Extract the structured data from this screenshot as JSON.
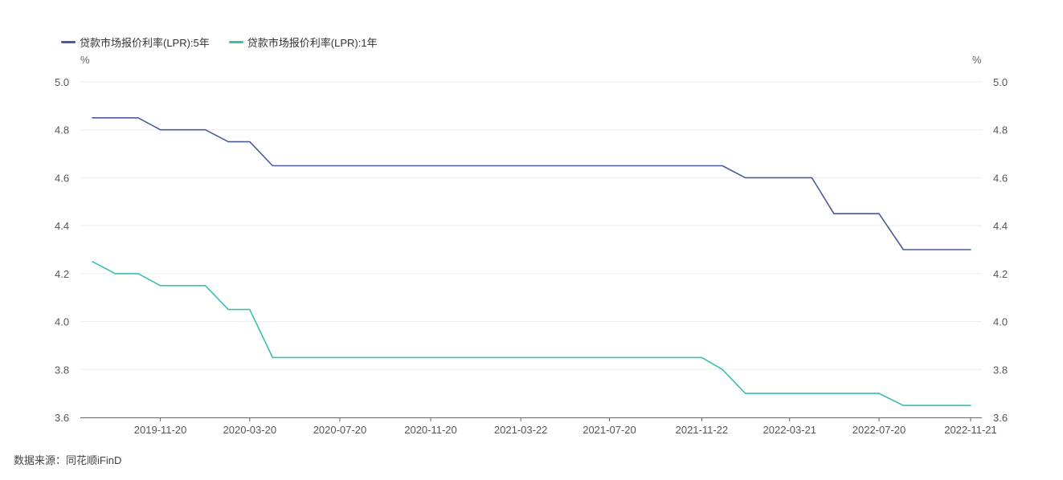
{
  "source": "数据来源：同花顺iFinD",
  "chart_data": {
    "type": "line",
    "unit_left": "%",
    "unit_right": "%",
    "ylim": [
      3.6,
      5.0
    ],
    "yticks": [
      "5.0",
      "4.8",
      "4.6",
      "4.4",
      "4.2",
      "4.0",
      "3.8",
      "3.6"
    ],
    "y2ticks": [
      "5.0",
      "4.8",
      "4.6",
      "4.4",
      "4.2",
      "4.0",
      "3.8",
      "3.6"
    ],
    "xticks": [
      "2019-11-20",
      "2020-03-20",
      "2020-07-20",
      "2020-11-20",
      "2021-03-22",
      "2021-07-20",
      "2021-11-22",
      "2022-03-21",
      "2022-07-20",
      "2022-11-21"
    ],
    "x": [
      "2019-08-20",
      "2019-09-20",
      "2019-10-21",
      "2019-11-20",
      "2019-12-20",
      "2020-01-20",
      "2020-02-20",
      "2020-03-20",
      "2020-04-20",
      "2020-05-20",
      "2020-06-22",
      "2020-07-20",
      "2020-08-20",
      "2020-09-21",
      "2020-10-20",
      "2020-11-20",
      "2020-12-21",
      "2021-01-20",
      "2021-02-20",
      "2021-03-22",
      "2021-04-20",
      "2021-05-20",
      "2021-06-21",
      "2021-07-20",
      "2021-08-20",
      "2021-09-22",
      "2021-10-20",
      "2021-11-22",
      "2021-12-20",
      "2022-01-20",
      "2022-02-21",
      "2022-03-21",
      "2022-04-20",
      "2022-05-20",
      "2022-06-20",
      "2022-07-20",
      "2022-08-22",
      "2022-09-20",
      "2022-10-20",
      "2022-11-21"
    ],
    "series": [
      {
        "name": "贷款市场报价利率(LPR):5年",
        "color": "#4a5a9a",
        "values": [
          4.85,
          4.85,
          4.85,
          4.8,
          4.8,
          4.8,
          4.75,
          4.75,
          4.65,
          4.65,
          4.65,
          4.65,
          4.65,
          4.65,
          4.65,
          4.65,
          4.65,
          4.65,
          4.65,
          4.65,
          4.65,
          4.65,
          4.65,
          4.65,
          4.65,
          4.65,
          4.65,
          4.65,
          4.65,
          4.6,
          4.6,
          4.6,
          4.6,
          4.45,
          4.45,
          4.45,
          4.3,
          4.3,
          4.3,
          4.3
        ]
      },
      {
        "name": "贷款市场报价利率(LPR):1年",
        "color": "#3dbfae",
        "values": [
          4.25,
          4.2,
          4.2,
          4.15,
          4.15,
          4.15,
          4.05,
          4.05,
          3.85,
          3.85,
          3.85,
          3.85,
          3.85,
          3.85,
          3.85,
          3.85,
          3.85,
          3.85,
          3.85,
          3.85,
          3.85,
          3.85,
          3.85,
          3.85,
          3.85,
          3.85,
          3.85,
          3.85,
          3.8,
          3.7,
          3.7,
          3.7,
          3.7,
          3.7,
          3.7,
          3.7,
          3.65,
          3.65,
          3.65,
          3.65
        ]
      }
    ]
  }
}
